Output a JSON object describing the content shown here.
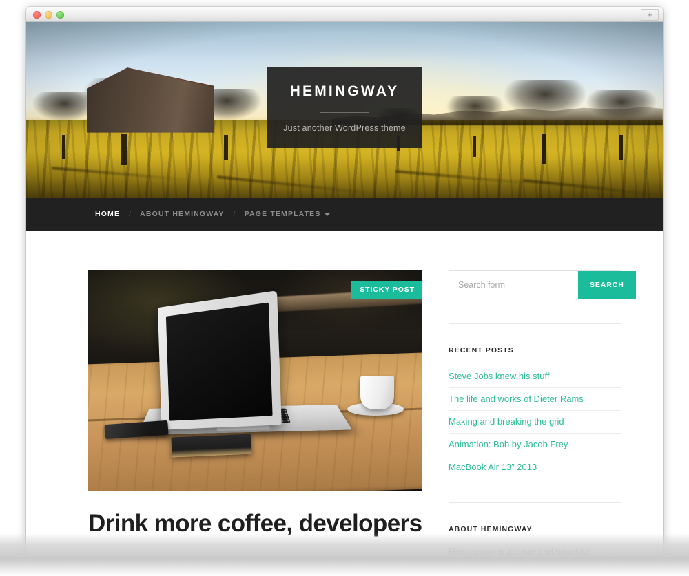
{
  "browser": {
    "traffic_lights": [
      "close",
      "minimize",
      "zoom"
    ],
    "new_tab_label": "+"
  },
  "site": {
    "title": "HEMINGWAY",
    "tagline": "Just another WordPress theme"
  },
  "nav": {
    "separator": "/",
    "items": [
      {
        "label": "HOME",
        "current": true,
        "has_dropdown": false
      },
      {
        "label": "ABOUT HEMINGWAY",
        "current": false,
        "has_dropdown": false
      },
      {
        "label": "PAGE TEMPLATES",
        "current": false,
        "has_dropdown": true
      }
    ]
  },
  "post": {
    "sticky_badge": "STICKY POST",
    "title": "Drink more coffee, developers"
  },
  "sidebar": {
    "search": {
      "placeholder": "Search form",
      "value": "",
      "button_label": "SEARCH"
    },
    "recent_posts": {
      "title": "RECENT POSTS",
      "items": [
        "Steve Jobs knew his stuff",
        "The life and works of Dieter Rams",
        "Making and breaking the grid",
        "Animation: Bob by Jacob Frey",
        "MacBook Air 13″ 2013"
      ]
    },
    "about": {
      "title": "ABOUT HEMINGWAY",
      "text": "Hemingway is a clean and beautiful"
    }
  },
  "colors": {
    "accent": "#1bbc9b",
    "link": "#2ebd9a",
    "nav_background": "#212121",
    "title_plate": "#212121",
    "heading": "#1f1f1f"
  }
}
